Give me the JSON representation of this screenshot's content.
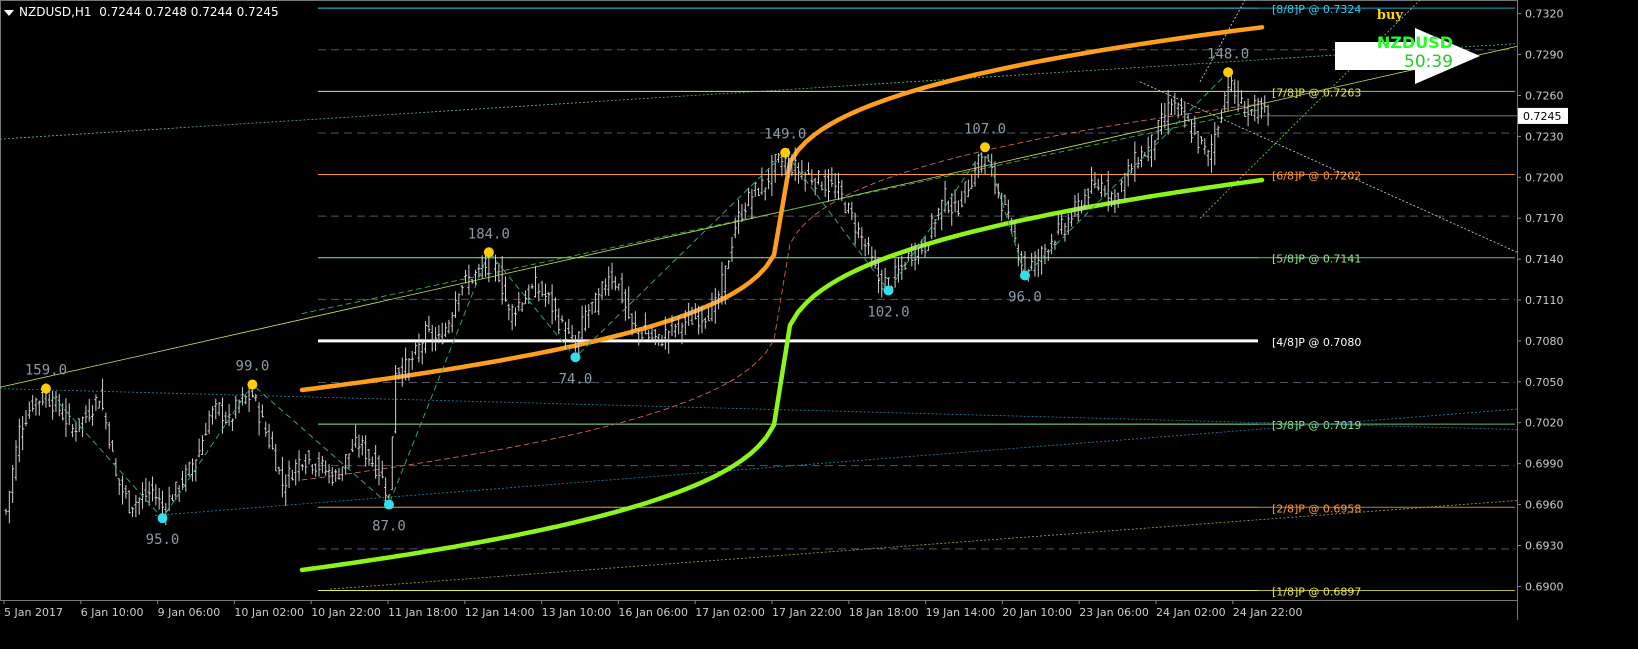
{
  "header": {
    "symbol_tf": "NZDUSD,H1",
    "ohlc": "0.7244 0.7248 0.7244 0.7245"
  },
  "signal": {
    "action": "buy",
    "symbol": "NZDUSD",
    "timer": "50:39"
  },
  "colors": {
    "background": "#000000",
    "upper_band": "#ff9f1c",
    "lower_band": "#8cf51c",
    "swing_high": "#ffcc00",
    "swing_low": "#33ddee",
    "median_line": "#ffffff"
  },
  "chart_data": {
    "type": "line",
    "title": "",
    "grid": false,
    "price_axis": {
      "ticks": [
        "0.7320",
        "0.7290",
        "0.7260",
        "0.7230",
        "0.7200",
        "0.7170",
        "0.7140",
        "0.7110",
        "0.7080",
        "0.7050",
        "0.7020",
        "0.6990",
        "0.6960",
        "0.6930",
        "0.6900"
      ],
      "current_price": "0.7245",
      "range": [
        0.689,
        0.733
      ]
    },
    "time_axis": {
      "labels": [
        "5 Jan 2017",
        "6 Jan 10:00",
        "9 Jan 06:00",
        "10 Jan 02:00",
        "10 Jan 22:00",
        "11 Jan 18:00",
        "12 Jan 14:00",
        "13 Jan 10:00",
        "16 Jan 06:00",
        "17 Jan 02:00",
        "17 Jan 22:00",
        "18 Jan 18:00",
        "19 Jan 14:00",
        "20 Jan 10:00",
        "23 Jan 06:00",
        "24 Jan 02:00",
        "24 Jan 22:00"
      ]
    },
    "murrey_levels": [
      {
        "label": "[8/8]P @ 0.7324",
        "price": 0.7324,
        "color": "#33ccee"
      },
      {
        "label": "[7/8]P @ 0.7263",
        "price": 0.7263,
        "color": "#e8e84a"
      },
      {
        "label": "[6/8]P @ 0.7202",
        "price": 0.7202,
        "color": "#ff9933"
      },
      {
        "label": "[5/8]P @ 0.7141",
        "price": 0.7141,
        "color": "#8ee88e"
      },
      {
        "label": "[4/8]P @ 0.7080",
        "price": 0.708,
        "color": "#ffffff"
      },
      {
        "label": "[3/8]P @ 0.7019",
        "price": 0.7019,
        "color": "#8ee88e"
      },
      {
        "label": "[2/8]P @ 0.6958",
        "price": 0.6958,
        "color": "#ff9933"
      },
      {
        "label": "[1/8]P @ 0.6897",
        "price": 0.6897,
        "color": "#e8e84a"
      }
    ],
    "swing_points": [
      {
        "label": "159.0",
        "type": "high",
        "bar": 12,
        "price": 0.7045
      },
      {
        "label": "95.0",
        "type": "low",
        "bar": 47,
        "price": 0.695
      },
      {
        "label": "99.0",
        "type": "high",
        "bar": 74,
        "price": 0.7048
      },
      {
        "label": "87.0",
        "type": "low",
        "bar": 115,
        "price": 0.696
      },
      {
        "label": "184.0",
        "type": "high",
        "bar": 145,
        "price": 0.7145
      },
      {
        "label": "74.0",
        "type": "low",
        "bar": 171,
        "price": 0.7068
      },
      {
        "label": "149.0",
        "type": "high",
        "bar": 234,
        "price": 0.7218
      },
      {
        "label": "102.0",
        "type": "low",
        "bar": 265,
        "price": 0.7117
      },
      {
        "label": "107.0",
        "type": "high",
        "bar": 294,
        "price": 0.7222
      },
      {
        "label": "96.0",
        "type": "low",
        "bar": 306,
        "price": 0.7128
      },
      {
        "label": "148.0",
        "type": "high",
        "bar": 367,
        "price": 0.7277
      }
    ],
    "price_path": [
      [
        0,
        0.6955
      ],
      [
        4,
        0.7015
      ],
      [
        8,
        0.7035
      ],
      [
        12,
        0.704
      ],
      [
        16,
        0.703
      ],
      [
        20,
        0.7015
      ],
      [
        24,
        0.7025
      ],
      [
        28,
        0.704
      ],
      [
        31,
        0.701
      ],
      [
        33,
        0.698
      ],
      [
        37,
        0.696
      ],
      [
        41,
        0.6965
      ],
      [
        44,
        0.697
      ],
      [
        47,
        0.6958
      ],
      [
        51,
        0.697
      ],
      [
        55,
        0.6985
      ],
      [
        58,
        0.7
      ],
      [
        61,
        0.7025
      ],
      [
        64,
        0.703
      ],
      [
        67,
        0.702
      ],
      [
        70,
        0.7035
      ],
      [
        74,
        0.704
      ],
      [
        77,
        0.702
      ],
      [
        80,
        0.7
      ],
      [
        83,
        0.6975
      ],
      [
        86,
        0.6985
      ],
      [
        89,
        0.6995
      ],
      [
        93,
        0.699
      ],
      [
        96,
        0.6985
      ],
      [
        99,
        0.698
      ],
      [
        103,
        0.6998
      ],
      [
        106,
        0.7005
      ],
      [
        109,
        0.6995
      ],
      [
        112,
        0.6985
      ],
      [
        115,
        0.6965
      ],
      [
        117,
        0.706
      ],
      [
        120,
        0.706
      ],
      [
        123,
        0.707
      ],
      [
        126,
        0.7085
      ],
      [
        130,
        0.708
      ],
      [
        133,
        0.7095
      ],
      [
        136,
        0.712
      ],
      [
        139,
        0.7125
      ],
      [
        142,
        0.713
      ],
      [
        145,
        0.7138
      ],
      [
        148,
        0.713
      ],
      [
        151,
        0.71
      ],
      [
        155,
        0.711
      ],
      [
        159,
        0.712
      ],
      [
        163,
        0.711
      ],
      [
        167,
        0.709
      ],
      [
        171,
        0.7075
      ],
      [
        174,
        0.71
      ],
      [
        178,
        0.711
      ],
      [
        181,
        0.713
      ],
      [
        184,
        0.712
      ],
      [
        188,
        0.709
      ],
      [
        192,
        0.7085
      ],
      [
        196,
        0.708
      ],
      [
        200,
        0.709
      ],
      [
        205,
        0.7095
      ],
      [
        210,
        0.71
      ],
      [
        213,
        0.7105
      ],
      [
        216,
        0.713
      ],
      [
        219,
        0.7165
      ],
      [
        222,
        0.718
      ],
      [
        225,
        0.719
      ],
      [
        228,
        0.7195
      ],
      [
        231,
        0.721
      ],
      [
        234,
        0.7212
      ],
      [
        238,
        0.7205
      ],
      [
        242,
        0.72
      ],
      [
        246,
        0.7195
      ],
      [
        250,
        0.719
      ],
      [
        254,
        0.717
      ],
      [
        258,
        0.715
      ],
      [
        262,
        0.7125
      ],
      [
        265,
        0.7122
      ],
      [
        268,
        0.713
      ],
      [
        272,
        0.7145
      ],
      [
        276,
        0.715
      ],
      [
        279,
        0.717
      ],
      [
        282,
        0.7185
      ],
      [
        285,
        0.7175
      ],
      [
        288,
        0.719
      ],
      [
        291,
        0.7205
      ],
      [
        294,
        0.7215
      ],
      [
        298,
        0.719
      ],
      [
        302,
        0.716
      ],
      [
        306,
        0.7132
      ],
      [
        310,
        0.714
      ],
      [
        314,
        0.7155
      ],
      [
        318,
        0.7165
      ],
      [
        321,
        0.7175
      ],
      [
        325,
        0.719
      ],
      [
        329,
        0.7195
      ],
      [
        333,
        0.7185
      ],
      [
        336,
        0.72
      ],
      [
        340,
        0.7215
      ],
      [
        343,
        0.722
      ],
      [
        347,
        0.724
      ],
      [
        350,
        0.7255
      ],
      [
        353,
        0.7245
      ],
      [
        357,
        0.723
      ],
      [
        361,
        0.7215
      ],
      [
        364,
        0.724
      ],
      [
        367,
        0.727
      ],
      [
        370,
        0.7255
      ],
      [
        373,
        0.7248
      ],
      [
        376,
        0.725
      ],
      [
        379,
        0.7245
      ]
    ]
  }
}
